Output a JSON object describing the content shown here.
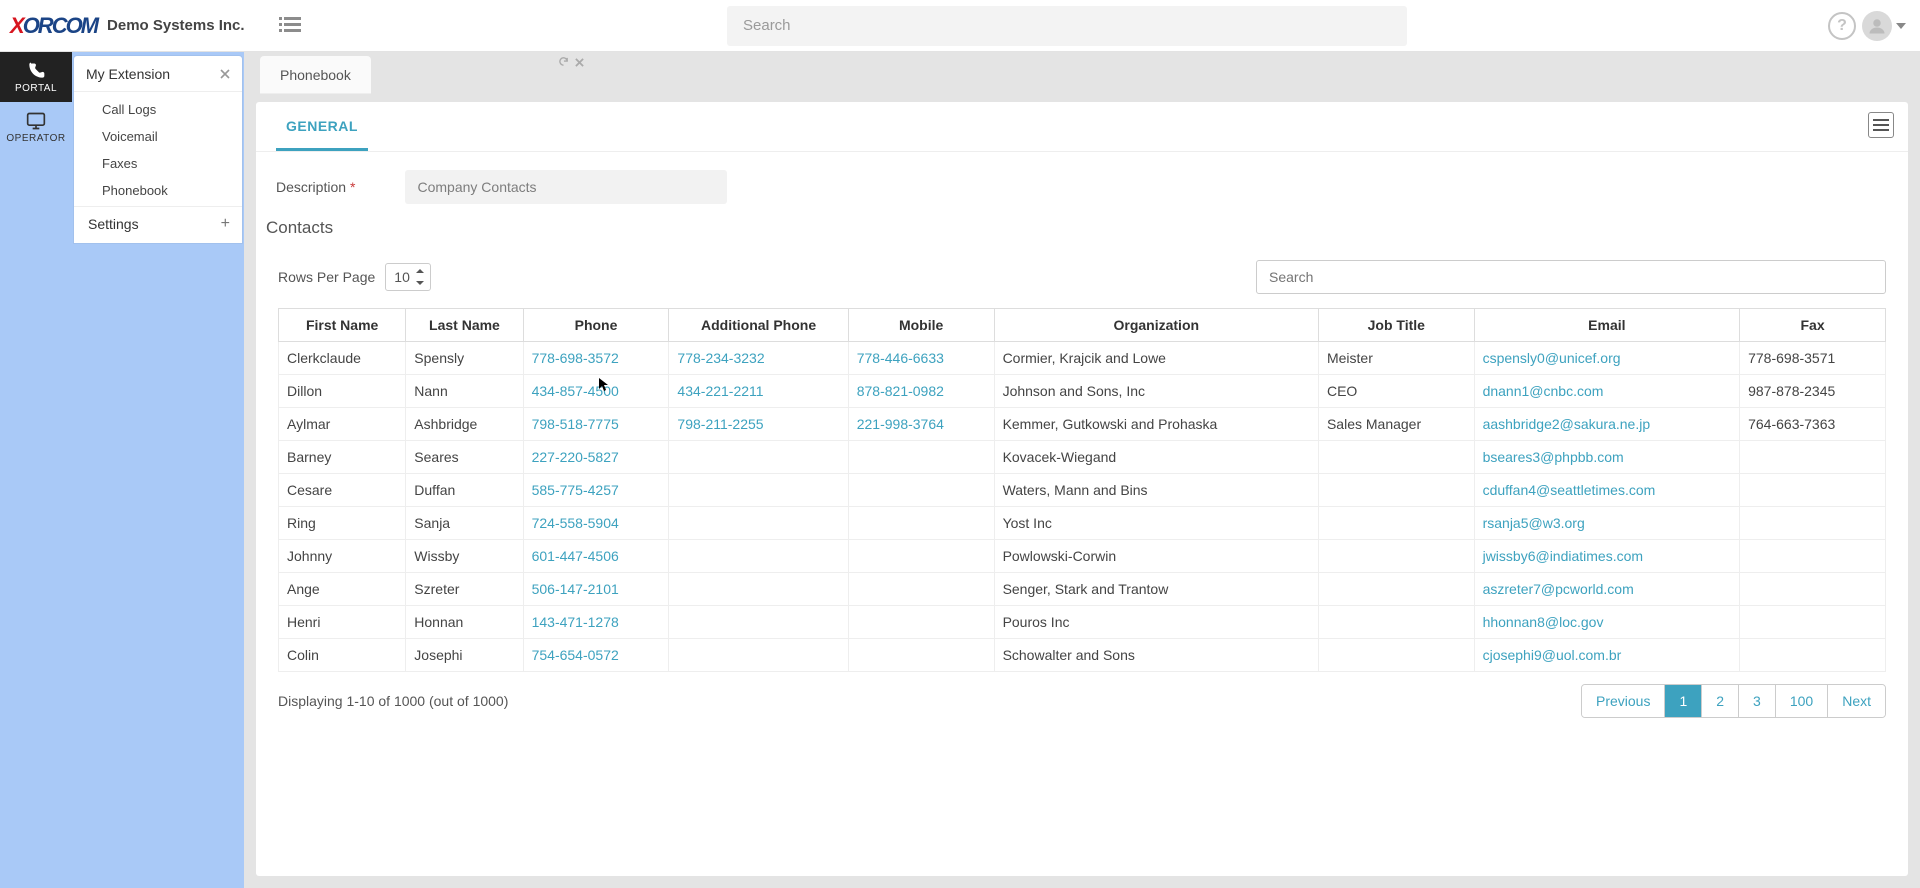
{
  "header": {
    "brand_main": "XORCOM",
    "brand_sub": "Demo Systems Inc.",
    "search_placeholder": "Search"
  },
  "rail": {
    "items": [
      {
        "key": "portal",
        "label": "PORTAL",
        "icon": "phone",
        "active": true
      },
      {
        "key": "operator",
        "label": "OPERATOR",
        "icon": "monitor",
        "active": false
      }
    ]
  },
  "sidebar": {
    "panel_title": "My Extension",
    "items": [
      {
        "label": "Call Logs"
      },
      {
        "label": "Voicemail"
      },
      {
        "label": "Faxes"
      },
      {
        "label": "Phonebook"
      }
    ],
    "settings_label": "Settings"
  },
  "tabs": {
    "main": "Phonebook"
  },
  "card": {
    "tab_general": "GENERAL",
    "description_label": "Description",
    "description_value": "Company Contacts",
    "section_title": "Contacts"
  },
  "table": {
    "rows_per_page_label": "Rows Per Page",
    "rows_per_page_value": "10",
    "search_placeholder": "Search",
    "columns": [
      "First Name",
      "Last Name",
      "Phone",
      "Additional Phone",
      "Mobile",
      "Organization",
      "Job Title",
      "Email",
      "Fax"
    ],
    "rows": [
      {
        "first": "Clerkclaude",
        "last": "Spensly",
        "phone": "778-698-3572",
        "addl": "778-234-3232",
        "mobile": "778-446-6633",
        "org": "Cormier, Krajcik and Lowe",
        "title": "Meister",
        "email": "cspensly0@unicef.org",
        "fax": "778-698-3571"
      },
      {
        "first": "Dillon",
        "last": "Nann",
        "phone": "434-857-4500",
        "addl": "434-221-2211",
        "mobile": "878-821-0982",
        "org": "Johnson and Sons, Inc",
        "title": "CEO",
        "email": "dnann1@cnbc.com",
        "fax": "987-878-2345"
      },
      {
        "first": "Aylmar",
        "last": "Ashbridge",
        "phone": "798-518-7775",
        "addl": "798-211-2255",
        "mobile": "221-998-3764",
        "org": "Kemmer, Gutkowski and Prohaska",
        "title": "Sales Manager",
        "email": "aashbridge2@sakura.ne.jp",
        "fax": "764-663-7363"
      },
      {
        "first": "Barney",
        "last": "Seares",
        "phone": "227-220-5827",
        "addl": "",
        "mobile": "",
        "org": "Kovacek-Wiegand",
        "title": "",
        "email": "bseares3@phpbb.com",
        "fax": ""
      },
      {
        "first": "Cesare",
        "last": "Duffan",
        "phone": "585-775-4257",
        "addl": "",
        "mobile": "",
        "org": "Waters, Mann and Bins",
        "title": "",
        "email": "cduffan4@seattletimes.com",
        "fax": ""
      },
      {
        "first": "Ring",
        "last": "Sanja",
        "phone": "724-558-5904",
        "addl": "",
        "mobile": "",
        "org": "Yost Inc",
        "title": "",
        "email": "rsanja5@w3.org",
        "fax": ""
      },
      {
        "first": "Johnny",
        "last": "Wissby",
        "phone": "601-447-4506",
        "addl": "",
        "mobile": "",
        "org": "Powlowski-Corwin",
        "title": "",
        "email": "jwissby6@indiatimes.com",
        "fax": ""
      },
      {
        "first": "Ange",
        "last": "Szreter",
        "phone": "506-147-2101",
        "addl": "",
        "mobile": "",
        "org": "Senger, Stark and Trantow",
        "title": "",
        "email": "aszreter7@pcworld.com",
        "fax": ""
      },
      {
        "first": "Henri",
        "last": "Honnan",
        "phone": "143-471-1278",
        "addl": "",
        "mobile": "",
        "org": "Pouros Inc",
        "title": "",
        "email": "hhonnan8@loc.gov",
        "fax": ""
      },
      {
        "first": "Colin",
        "last": "Josephi",
        "phone": "754-654-0572",
        "addl": "",
        "mobile": "",
        "org": "Schowalter and Sons",
        "title": "",
        "email": "cjosephi9@uol.com.br",
        "fax": ""
      }
    ],
    "footer_display": "Displaying 1-10 of 1000 (out of 1000)",
    "pages": [
      "Previous",
      "1",
      "2",
      "3",
      "100",
      "Next"
    ],
    "active_page": "1"
  }
}
